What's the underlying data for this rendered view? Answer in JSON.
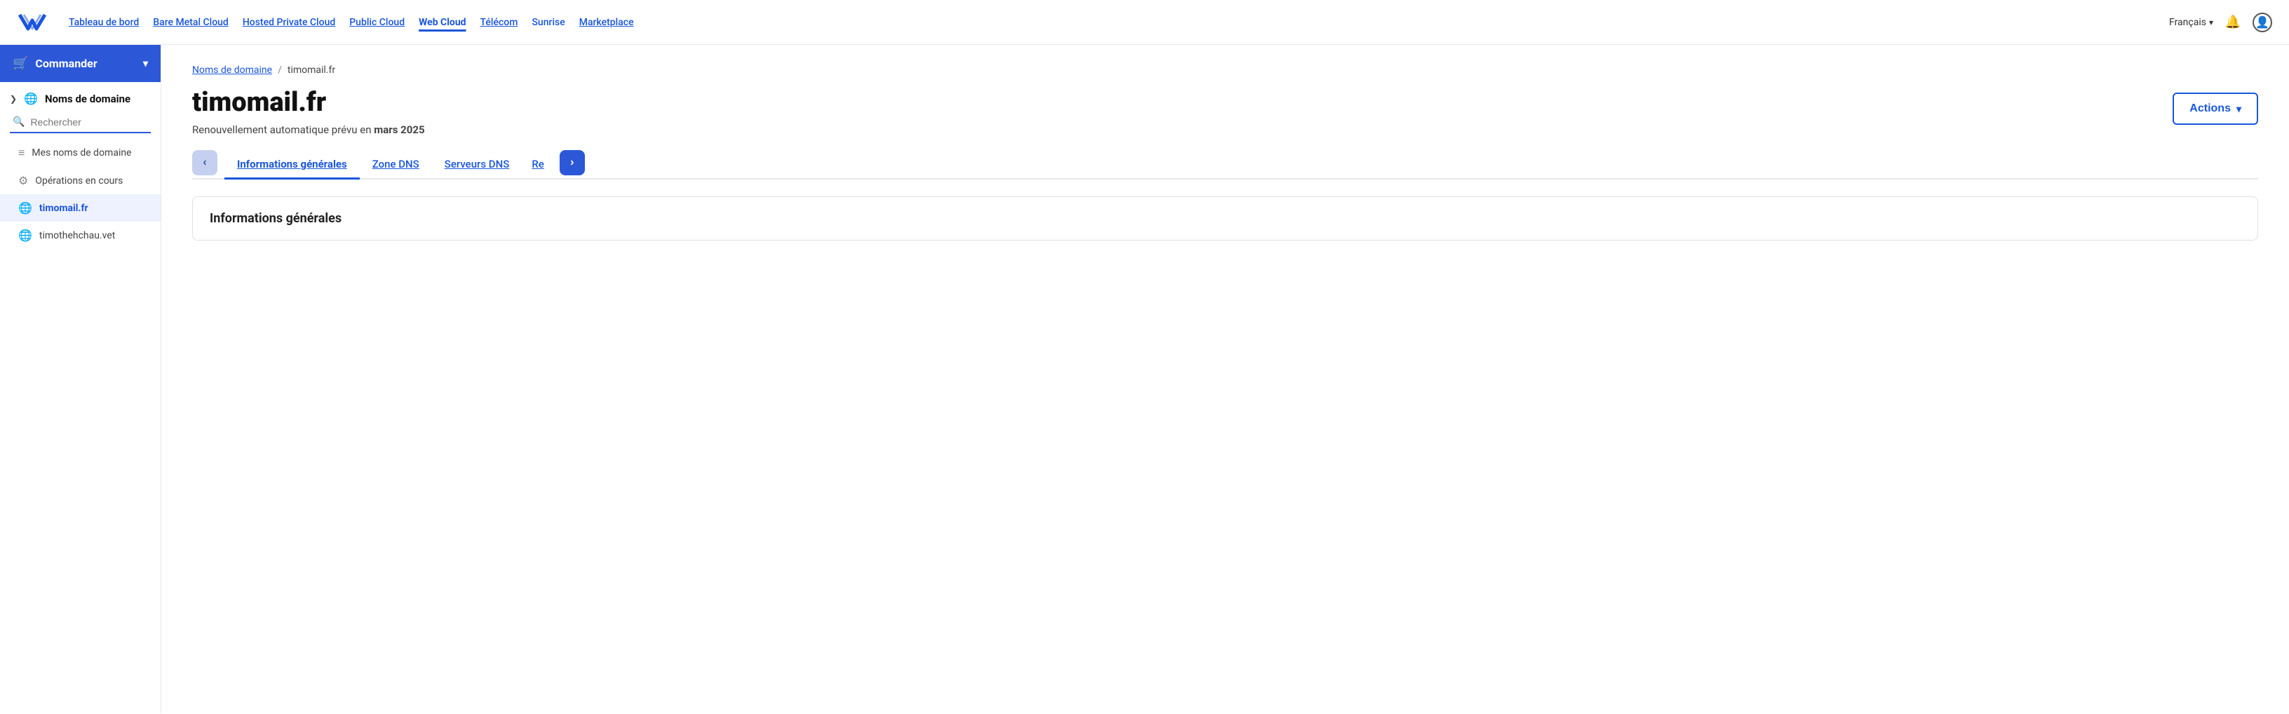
{
  "nav": {
    "links": [
      {
        "id": "tableau",
        "label": "Tableau de bord",
        "active": false
      },
      {
        "id": "bare-metal",
        "label": "Bare Metal Cloud",
        "active": false
      },
      {
        "id": "hosted-private",
        "label": "Hosted Private Cloud",
        "active": false
      },
      {
        "id": "public-cloud",
        "label": "Public Cloud",
        "active": false
      },
      {
        "id": "web-cloud",
        "label": "Web Cloud",
        "active": true
      },
      {
        "id": "telecom",
        "label": "Télécom",
        "active": false
      },
      {
        "id": "sunrise",
        "label": "Sunrise",
        "active": false
      },
      {
        "id": "marketplace",
        "label": "Marketplace",
        "active": false
      }
    ],
    "language": "Français"
  },
  "sidebar": {
    "commander_label": "Commander",
    "section_title": "Noms de domaine",
    "search_placeholder": "Rechercher",
    "items": [
      {
        "id": "mes-domaines",
        "label": "Mes noms de domaine",
        "icon": "≡",
        "active": false
      },
      {
        "id": "operations",
        "label": "Opérations en cours",
        "icon": "⚙",
        "active": false
      },
      {
        "id": "timomail",
        "label": "timomail.fr",
        "icon": "🌐",
        "active": true
      },
      {
        "id": "timothehchau",
        "label": "timothehchau.vet",
        "icon": "🌐",
        "active": false
      }
    ]
  },
  "main": {
    "breadcrumb_link": "Noms de domaine",
    "breadcrumb_separator": "/",
    "breadcrumb_current": "timomail.fr",
    "page_title": "timomail.fr",
    "renewal_text": "Renouvellement automatique prévu en ",
    "renewal_date": "mars 2025",
    "actions_label": "Actions",
    "tabs": [
      {
        "id": "infos",
        "label": "Informations générales",
        "active": true
      },
      {
        "id": "zone-dns",
        "label": "Zone DNS",
        "active": false
      },
      {
        "id": "serveurs-dns",
        "label": "Serveurs DNS",
        "active": false
      },
      {
        "id": "re",
        "label": "Re",
        "active": false
      }
    ],
    "section_title": "Informations générales"
  }
}
